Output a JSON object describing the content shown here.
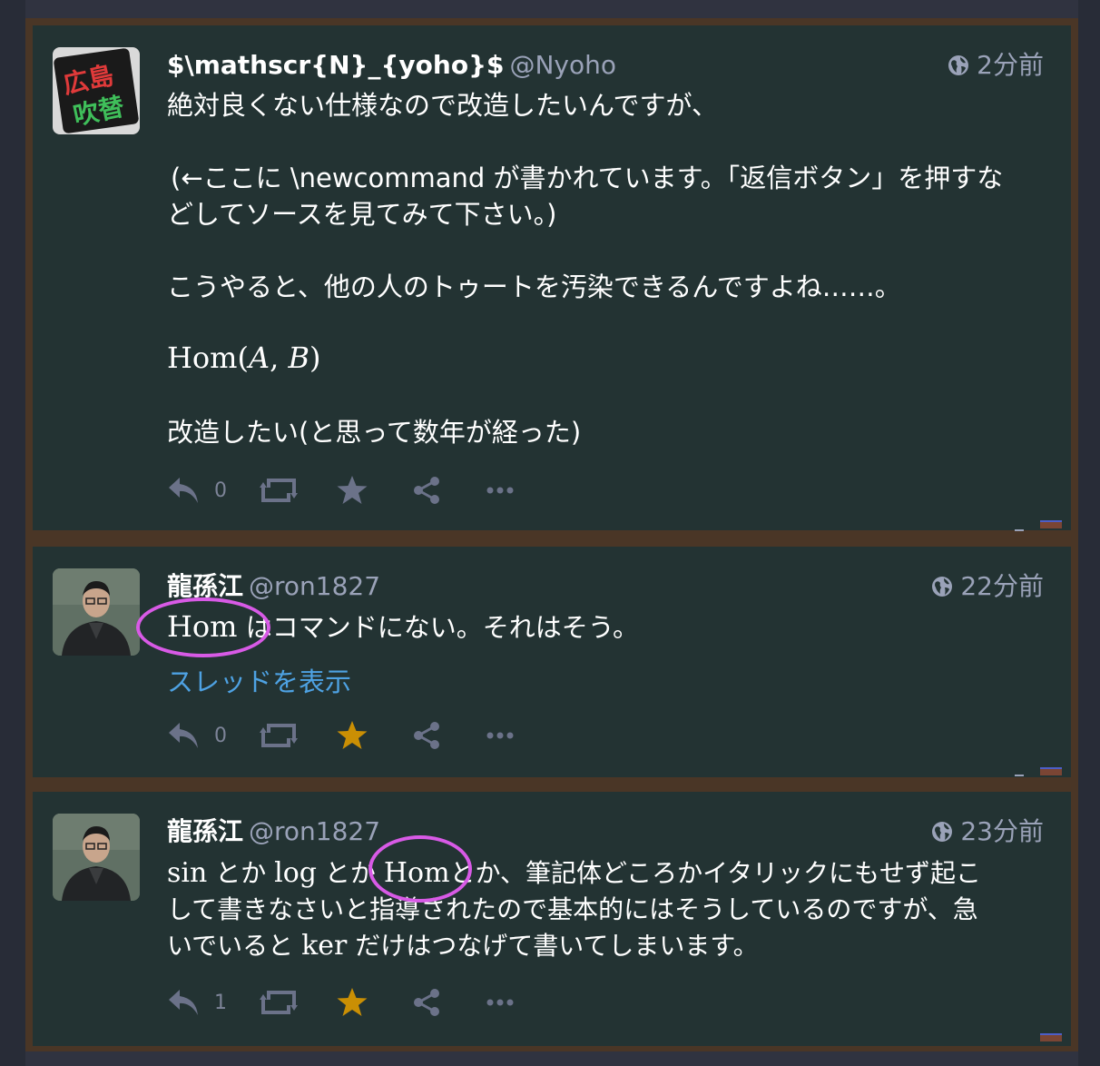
{
  "statuses": [
    {
      "display_name": "$\\mathscr{N}_{yoho}$",
      "acct": "@Nyoho",
      "time": "2分前",
      "lines": [
        "絶対良くない仕様なので改造したいんですが、",
        "(←ここに \\newcommand が書かれています。「返信ボタン」を押すな",
        "どしてソースを見てみて下さい。)",
        "こうやると、他の人のトゥートを汚染できるんですよね……。",
        "改造したい(と思って数年が経った)"
      ],
      "math_parts": [
        "Hom(",
        "A",
        ", ",
        "B",
        ")"
      ],
      "reply_count": "0",
      "favourited": false,
      "avatar_text": [
        "広島",
        "吹替"
      ]
    },
    {
      "display_name": "龍孫江",
      "acct": "@ron1827",
      "time": "22分前",
      "math_word": "Hom",
      "text_after": "はコマンドにない。それはそう。",
      "thread_link": "スレッドを表示",
      "reply_count": "0",
      "favourited": true
    },
    {
      "display_name": "龍孫江",
      "acct": "@ron1827",
      "time": "23分前",
      "line1_parts": [
        "sin",
        "とか",
        "log",
        "とか",
        "Hom",
        "とか、筆記体どころかイタリックにもせず起こ"
      ],
      "line2": "して書きなさいと指導されたので基本的にはそうしているのですが、急",
      "line3_parts": [
        "いでいると",
        "ker",
        "だけはつなげて書いてしまいます。"
      ],
      "reply_count": "1",
      "favourited": true
    }
  ],
  "colors": {
    "background": "#282c37",
    "card": "#233333",
    "accent_link": "#4ea2e3",
    "favourite_active": "#ca8f04",
    "action_idle": "#6b7289",
    "annotation_circle": "#d85ae6"
  },
  "icons": [
    "globe-icon",
    "reply-icon",
    "boost-icon",
    "star-icon",
    "share-icon",
    "more-icon"
  ]
}
